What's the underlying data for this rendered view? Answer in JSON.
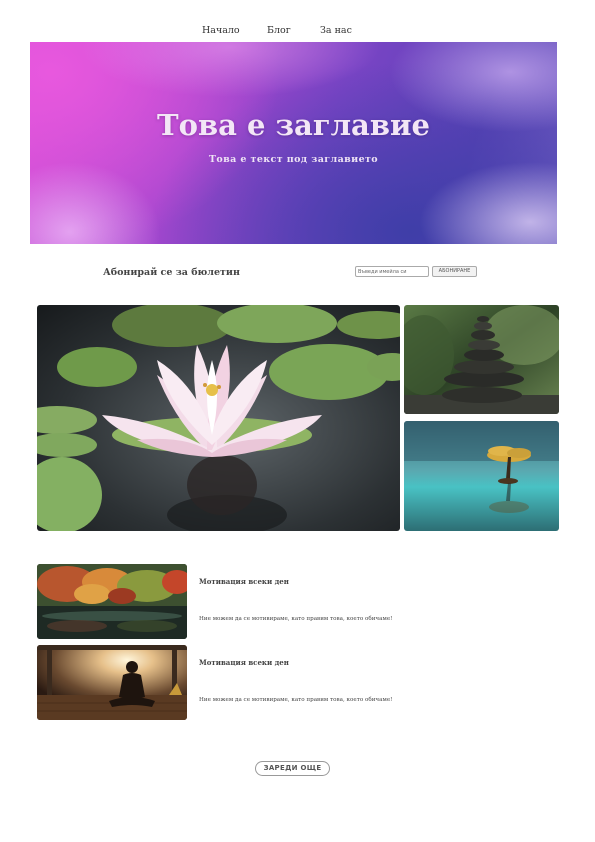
{
  "nav": {
    "items": [
      {
        "label": "Начало"
      },
      {
        "label": "Блог"
      },
      {
        "label": "За нас"
      }
    ]
  },
  "hero": {
    "title": "Това е заглавие",
    "subtitle": "Това е текст под заглавието"
  },
  "newsletter": {
    "label": "Абонирай се за бюлетин",
    "email_placeholder": "Въведи имейла си",
    "button_label": "АБОНИРАНЕ"
  },
  "gallery": {
    "images": [
      "lotus-flower",
      "stacked-stones",
      "tree-on-water"
    ]
  },
  "posts": [
    {
      "image": "autumn-forest-lake",
      "title": "Мотивация всеки ден",
      "text": "Ние можем да се мотивираме, като правим това, което обичаме!"
    },
    {
      "image": "meditation-sunset",
      "title": "Мотивация всеки ден",
      "text": "Ние можем да се мотивираме, като правим това, което обичаме!"
    }
  ],
  "load_more": {
    "label": "ЗАРЕДИ ОЩЕ"
  }
}
